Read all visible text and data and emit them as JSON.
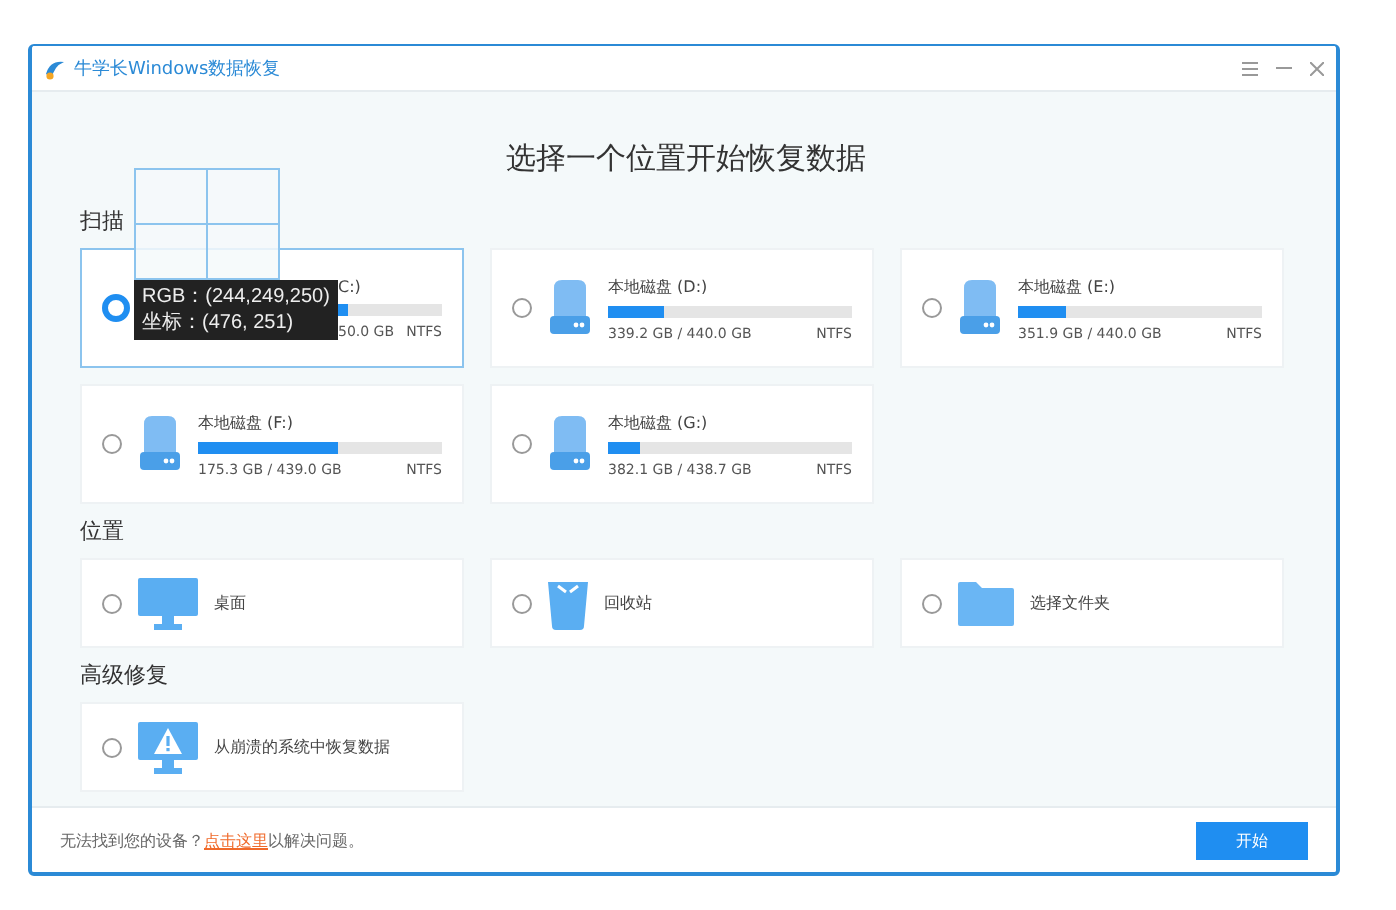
{
  "window": {
    "title": "牛学长Windows数据恢复"
  },
  "heading": "选择一个位置开始恢复数据",
  "sections": [
    {
      "title": "扫描",
      "kind": "drives",
      "items": [
        {
          "kind": "drive_covered",
          "name": "C:)",
          "usage": "50.0 GB",
          "fs": "NTFS",
          "level": 0.1,
          "selected": true
        },
        {
          "kind": "drive",
          "name": "本地磁盘 (D:)",
          "usage": "339.2 GB / 440.0 GB",
          "fs": "NTFS",
          "level": 0.23,
          "selected": false
        },
        {
          "kind": "drive",
          "name": "本地磁盘 (E:)",
          "usage": "351.9 GB / 440.0 GB",
          "fs": "NTFS",
          "level": 0.2,
          "selected": false
        },
        {
          "kind": "drive",
          "name": "本地磁盘 (F:)",
          "usage": "175.3 GB / 439.0 GB",
          "fs": "NTFS",
          "level": 0.57,
          "selected": false
        },
        {
          "kind": "drive",
          "name": "本地磁盘 (G:)",
          "usage": "382.1 GB / 438.7 GB",
          "fs": "NTFS",
          "level": 0.13,
          "selected": false
        }
      ]
    },
    {
      "title": "位置",
      "kind": "locations",
      "items": [
        {
          "kind": "monitor",
          "label": "桌面",
          "selected": false
        },
        {
          "kind": "trash",
          "label": "回收站",
          "selected": false
        },
        {
          "kind": "folder",
          "label": "选择文件夹",
          "selected": false
        }
      ]
    },
    {
      "title": "高级修复",
      "kind": "locations",
      "items": [
        {
          "kind": "warning_monitor",
          "label": "从崩溃的系统中恢复数据",
          "selected": false
        }
      ]
    }
  ],
  "picker": {
    "rgb": "RGB：(244,249,250)",
    "coords": "坐标：(476, 251)"
  },
  "footer": {
    "before": "无法找到您的设备？",
    "link": "点击这里",
    "after": "以解决问题。",
    "button": "开始"
  }
}
